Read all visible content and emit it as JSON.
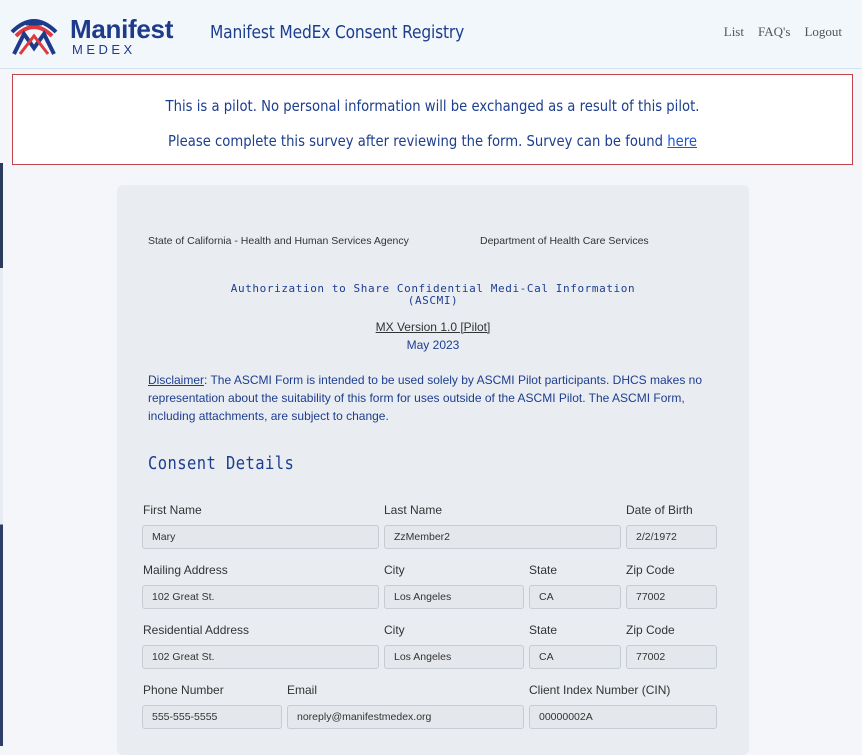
{
  "brand": {
    "name": "Manifest",
    "sub": "MEDEX"
  },
  "header": {
    "title": "Manifest MedEx Consent Registry"
  },
  "nav": [
    "List",
    "FAQ's",
    "Logout"
  ],
  "notice": {
    "line1": "This is a pilot. No personal information will be exchanged as a result of this pilot.",
    "line2_prefix": "Please complete this survey after reviewing the form. Survey can be found ",
    "link": "here"
  },
  "form": {
    "agency_left": "State of California - Health and Human Services Agency",
    "agency_right": "Department of Health Care Services",
    "title_line1": "Authorization to Share Confidential Medi-Cal Information",
    "title_line2": "(ASCMI)",
    "version": "MX Version 1.0 [Pilot]",
    "date": "May 2023",
    "disclaimer_label": "Disclaimer",
    "disclaimer_text": ": The ASCMI Form is intended to be used solely by ASCMI Pilot participants. DHCS makes no representation about the suitability of this form for uses outside of the ASCMI Pilot. The ASCMI Form, including attachments, are subject to change."
  },
  "consent": {
    "section_title": "Consent Details",
    "first_name": {
      "label": "First Name",
      "value": "Mary"
    },
    "last_name": {
      "label": "Last Name",
      "value": "ZzMember2"
    },
    "dob": {
      "label": "Date of Birth",
      "value": "2/2/1972"
    },
    "mailing_address": {
      "label": "Mailing Address",
      "value": "102 Great St."
    },
    "mailing_city": {
      "label": "City",
      "value": "Los Angeles"
    },
    "mailing_state": {
      "label": "State",
      "value": "CA"
    },
    "mailing_zip": {
      "label": "Zip Code",
      "value": "77002"
    },
    "residential_address": {
      "label": "Residential Address",
      "value": "102 Great St."
    },
    "residential_city": {
      "label": "City",
      "value": "Los Angeles"
    },
    "residential_state": {
      "label": "State",
      "value": "CA"
    },
    "residential_zip": {
      "label": "Zip Code",
      "value": "77002"
    },
    "phone": {
      "label": "Phone Number",
      "value": "555-555-5555"
    },
    "email": {
      "label": "Email",
      "value": "noreply@manifestmedex.org"
    },
    "cin": {
      "label": "Client Index Number (CIN)",
      "value": "00000002A"
    }
  },
  "colors": {
    "brand_navy": "#1e3a8a",
    "brand_red": "#e0393e",
    "notice_border": "#c0444b"
  }
}
